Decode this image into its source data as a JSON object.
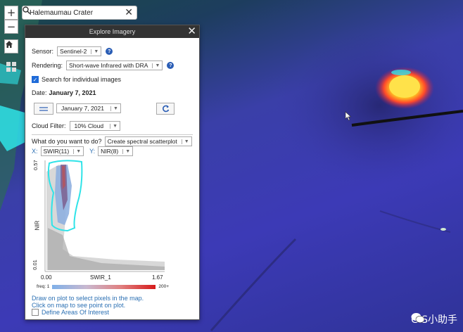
{
  "search": {
    "value": "Halemaumau Crater"
  },
  "zoom": {
    "in": "+",
    "out": "−"
  },
  "panel": {
    "title": "Explore Imagery",
    "sensor_label": "Sensor:",
    "sensor_value": "Sentinel-2",
    "rendering_label": "Rendering:",
    "rendering_value": "Short-wave Infrared with DRA",
    "search_individual": "Search for individual images",
    "date_label": "Date:",
    "date_value": "January 7, 2021",
    "date_select": "January 7, 2021",
    "cloud_label": "Cloud Filter:",
    "cloud_value": "10% Cloud",
    "todo_label": "What do you want to do?",
    "todo_value": "Create spectral scatterplot",
    "x_label": "X:",
    "x_value": "SWIR(11)",
    "y_label": "Y:",
    "y_value": "NIR(8)",
    "plot": {
      "y_axis_title": "NIR",
      "x_axis_title": "SWIR_1",
      "y_max": "0.57",
      "y_min": "0.01",
      "x_min": "0.00",
      "x_max": "1.67",
      "freq_min": "freq: 1",
      "freq_max": "200+"
    },
    "hint1": "Draw on plot to select pixels in the map.",
    "hint2": "Click on map to see point on plot.",
    "define_aoi": "Define Areas Of Interest"
  },
  "watermark": "GIS小助手",
  "colors": {
    "accent": "#1f6bd8",
    "panel_header": "#333333",
    "cyan": "#2fe3e8"
  }
}
